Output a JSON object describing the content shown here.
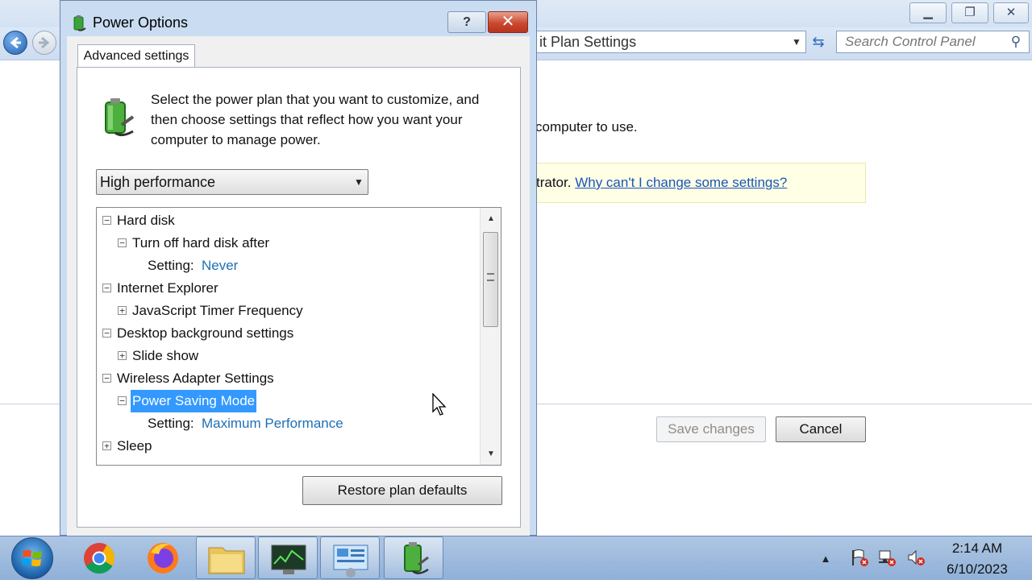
{
  "background_window": {
    "address_text": "it Plan Settings",
    "search_placeholder": "Search Control Panel",
    "body_text": "computer to use.",
    "info_text": "trator.",
    "info_link": "Why can't I change some settings?",
    "save_label": "Save changes",
    "cancel_label": "Cancel"
  },
  "dialog": {
    "title": "Power Options",
    "help_label": "?",
    "close_label": "✕",
    "tab_label": "Advanced settings",
    "description": "Select the power plan that you want to customize, and then choose settings that reflect how you want your computer to manage power.",
    "plan_selected": "High performance",
    "restore_label": "Restore plan defaults",
    "tree": [
      {
        "label": "Hard disk",
        "expander": "−"
      },
      {
        "label": "Turn off hard disk after",
        "expander": "−"
      },
      {
        "setting_key": "Setting:",
        "setting_value": "Never"
      },
      {
        "label": "Internet Explorer",
        "expander": "−"
      },
      {
        "label": "JavaScript Timer Frequency",
        "expander": "+"
      },
      {
        "label": "Desktop background settings",
        "expander": "−"
      },
      {
        "label": "Slide show",
        "expander": "+"
      },
      {
        "label": "Wireless Adapter Settings",
        "expander": "−"
      },
      {
        "label": "Power Saving Mode",
        "expander": "−",
        "selected": true
      },
      {
        "setting_key": "Setting:",
        "setting_value": "Maximum Performance"
      },
      {
        "label": "Sleep",
        "expander": "+"
      }
    ]
  },
  "taskbar": {
    "apps": [
      "start",
      "chrome",
      "firefox",
      "file-explorer",
      "terminal",
      "control-panel",
      "power-options"
    ],
    "clock_time": "2:14 AM",
    "clock_date": "6/10/2023"
  },
  "colors": {
    "selection": "#3399ff",
    "setting_value": "#1e6fb5",
    "link": "#1a55b8"
  }
}
